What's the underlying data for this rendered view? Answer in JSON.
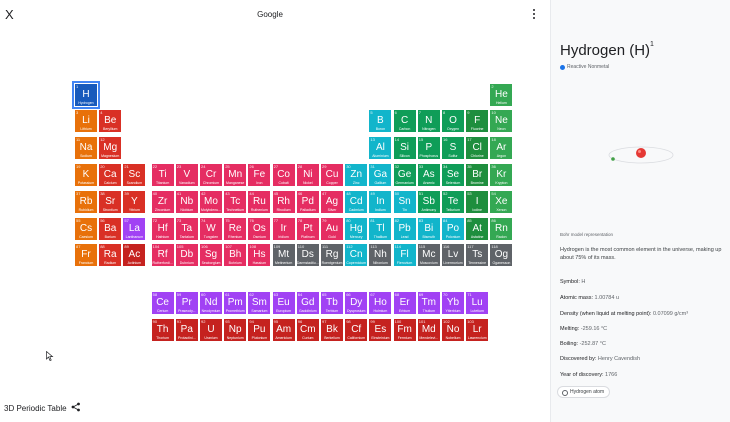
{
  "header": {
    "title": "Google",
    "close_glyph": "X"
  },
  "footer": {
    "app_title": "3D Periodic Table"
  },
  "colors": {
    "alkali": "#e8710a",
    "alkaline": "#d93025",
    "transition": "#e52d62",
    "post": "#12b5cb",
    "metalloid": "#0f9d58",
    "nonmetal": "#188038",
    "halogen": "#1e8e3e",
    "noble": "#34a853",
    "lanth": "#a142f4",
    "actin": "#c5221f",
    "unknown": "#5f6368",
    "hydrogen": "#185abc"
  },
  "elements": [
    {
      "z": 1,
      "s": "H",
      "n": "Hydrogen",
      "r": 1,
      "c": 1,
      "cat": "hydrogen"
    },
    {
      "z": 2,
      "s": "He",
      "n": "Helium",
      "r": 1,
      "c": 18,
      "cat": "noble"
    },
    {
      "z": 3,
      "s": "Li",
      "n": "Lithium",
      "r": 2,
      "c": 1,
      "cat": "alkali"
    },
    {
      "z": 4,
      "s": "Be",
      "n": "Beryllium",
      "r": 2,
      "c": 2,
      "cat": "alkaline"
    },
    {
      "z": 5,
      "s": "B",
      "n": "Boron",
      "r": 2,
      "c": 13,
      "cat": "post"
    },
    {
      "z": 6,
      "s": "C",
      "n": "Carbon",
      "r": 2,
      "c": 14,
      "cat": "metalloid"
    },
    {
      "z": 7,
      "s": "N",
      "n": "Nitrogen",
      "r": 2,
      "c": 15,
      "cat": "metalloid"
    },
    {
      "z": 8,
      "s": "O",
      "n": "Oxygen",
      "r": 2,
      "c": 16,
      "cat": "metalloid"
    },
    {
      "z": 9,
      "s": "F",
      "n": "Fluorine",
      "r": 2,
      "c": 17,
      "cat": "halogen"
    },
    {
      "z": 10,
      "s": "Ne",
      "n": "Neon",
      "r": 2,
      "c": 18,
      "cat": "noble"
    },
    {
      "z": 11,
      "s": "Na",
      "n": "Sodium",
      "r": 3,
      "c": 1,
      "cat": "alkali"
    },
    {
      "z": 12,
      "s": "Mg",
      "n": "Magnesium",
      "r": 3,
      "c": 2,
      "cat": "alkaline"
    },
    {
      "z": 13,
      "s": "Al",
      "n": "Aluminium",
      "r": 3,
      "c": 13,
      "cat": "post"
    },
    {
      "z": 14,
      "s": "Si",
      "n": "Silicon",
      "r": 3,
      "c": 14,
      "cat": "metalloid"
    },
    {
      "z": 15,
      "s": "P",
      "n": "Phosphorus",
      "r": 3,
      "c": 15,
      "cat": "metalloid"
    },
    {
      "z": 16,
      "s": "S",
      "n": "Sulfur",
      "r": 3,
      "c": 16,
      "cat": "metalloid"
    },
    {
      "z": 17,
      "s": "Cl",
      "n": "Chlorine",
      "r": 3,
      "c": 17,
      "cat": "halogen"
    },
    {
      "z": 18,
      "s": "Ar",
      "n": "Argon",
      "r": 3,
      "c": 18,
      "cat": "noble"
    },
    {
      "z": 19,
      "s": "K",
      "n": "Potassium",
      "r": 4,
      "c": 1,
      "cat": "alkali"
    },
    {
      "z": 20,
      "s": "Ca",
      "n": "Calcium",
      "r": 4,
      "c": 2,
      "cat": "alkaline"
    },
    {
      "z": 21,
      "s": "Sc",
      "n": "Scandium",
      "r": 4,
      "c": 3,
      "cat": "alkaline"
    },
    {
      "z": 22,
      "s": "Ti",
      "n": "Titanium",
      "r": 4,
      "c": 4,
      "cat": "transition"
    },
    {
      "z": 23,
      "s": "V",
      "n": "Vanadium",
      "r": 4,
      "c": 5,
      "cat": "transition"
    },
    {
      "z": 24,
      "s": "Cr",
      "n": "Chromium",
      "r": 4,
      "c": 6,
      "cat": "transition"
    },
    {
      "z": 25,
      "s": "Mn",
      "n": "Manganese",
      "r": 4,
      "c": 7,
      "cat": "transition"
    },
    {
      "z": 26,
      "s": "Fe",
      "n": "Iron",
      "r": 4,
      "c": 8,
      "cat": "transition"
    },
    {
      "z": 27,
      "s": "Co",
      "n": "Cobalt",
      "r": 4,
      "c": 9,
      "cat": "transition"
    },
    {
      "z": 28,
      "s": "Ni",
      "n": "Nickel",
      "r": 4,
      "c": 10,
      "cat": "transition"
    },
    {
      "z": 29,
      "s": "Cu",
      "n": "Copper",
      "r": 4,
      "c": 11,
      "cat": "transition"
    },
    {
      "z": 30,
      "s": "Zn",
      "n": "Zinc",
      "r": 4,
      "c": 12,
      "cat": "post"
    },
    {
      "z": 31,
      "s": "Ga",
      "n": "Gallium",
      "r": 4,
      "c": 13,
      "cat": "post"
    },
    {
      "z": 32,
      "s": "Ge",
      "n": "Germanium",
      "r": 4,
      "c": 14,
      "cat": "metalloid"
    },
    {
      "z": 33,
      "s": "As",
      "n": "Arsenic",
      "r": 4,
      "c": 15,
      "cat": "metalloid"
    },
    {
      "z": 34,
      "s": "Se",
      "n": "Selenium",
      "r": 4,
      "c": 16,
      "cat": "metalloid"
    },
    {
      "z": 35,
      "s": "Br",
      "n": "Bromine",
      "r": 4,
      "c": 17,
      "cat": "halogen"
    },
    {
      "z": 36,
      "s": "Kr",
      "n": "Krypton",
      "r": 4,
      "c": 18,
      "cat": "noble"
    },
    {
      "z": 37,
      "s": "Rb",
      "n": "Rubidium",
      "r": 5,
      "c": 1,
      "cat": "alkali"
    },
    {
      "z": 38,
      "s": "Sr",
      "n": "Strontium",
      "r": 5,
      "c": 2,
      "cat": "alkaline"
    },
    {
      "z": 39,
      "s": "Y",
      "n": "Yttrium",
      "r": 5,
      "c": 3,
      "cat": "alkaline"
    },
    {
      "z": 40,
      "s": "Zr",
      "n": "Zirconium",
      "r": 5,
      "c": 4,
      "cat": "transition"
    },
    {
      "z": 41,
      "s": "Nb",
      "n": "Niobium",
      "r": 5,
      "c": 5,
      "cat": "transition"
    },
    {
      "z": 42,
      "s": "Mo",
      "n": "Molybdenu...",
      "r": 5,
      "c": 6,
      "cat": "transition"
    },
    {
      "z": 43,
      "s": "Tc",
      "n": "Technetium",
      "r": 5,
      "c": 7,
      "cat": "transition"
    },
    {
      "z": 44,
      "s": "Ru",
      "n": "Ruthenium",
      "r": 5,
      "c": 8,
      "cat": "transition"
    },
    {
      "z": 45,
      "s": "Rh",
      "n": "Rhodium",
      "r": 5,
      "c": 9,
      "cat": "transition"
    },
    {
      "z": 46,
      "s": "Pd",
      "n": "Palladium",
      "r": 5,
      "c": 10,
      "cat": "transition"
    },
    {
      "z": 47,
      "s": "Ag",
      "n": "Silver",
      "r": 5,
      "c": 11,
      "cat": "transition"
    },
    {
      "z": 48,
      "s": "Cd",
      "n": "Cadmium",
      "r": 5,
      "c": 12,
      "cat": "post"
    },
    {
      "z": 49,
      "s": "In",
      "n": "Indium",
      "r": 5,
      "c": 13,
      "cat": "post"
    },
    {
      "z": 50,
      "s": "Sn",
      "n": "Tin",
      "r": 5,
      "c": 14,
      "cat": "post"
    },
    {
      "z": 51,
      "s": "Sb",
      "n": "Antimony",
      "r": 5,
      "c": 15,
      "cat": "metalloid"
    },
    {
      "z": 52,
      "s": "Te",
      "n": "Tellurium",
      "r": 5,
      "c": 16,
      "cat": "metalloid"
    },
    {
      "z": 53,
      "s": "I",
      "n": "Iodine",
      "r": 5,
      "c": 17,
      "cat": "halogen"
    },
    {
      "z": 54,
      "s": "Xe",
      "n": "Xenon",
      "r": 5,
      "c": 18,
      "cat": "noble"
    },
    {
      "z": 55,
      "s": "Cs",
      "n": "Caesium",
      "r": 6,
      "c": 1,
      "cat": "alkali"
    },
    {
      "z": 56,
      "s": "Ba",
      "n": "Barium",
      "r": 6,
      "c": 2,
      "cat": "alkaline"
    },
    {
      "z": 57,
      "s": "La",
      "n": "Lanthanum",
      "r": 6,
      "c": 3,
      "cat": "lanth"
    },
    {
      "z": 72,
      "s": "Hf",
      "n": "Hafnium",
      "r": 6,
      "c": 4,
      "cat": "transition"
    },
    {
      "z": 73,
      "s": "Ta",
      "n": "Tantalum",
      "r": 6,
      "c": 5,
      "cat": "transition"
    },
    {
      "z": 74,
      "s": "W",
      "n": "Tungsten",
      "r": 6,
      "c": 6,
      "cat": "transition"
    },
    {
      "z": 75,
      "s": "Re",
      "n": "Rhenium",
      "r": 6,
      "c": 7,
      "cat": "transition"
    },
    {
      "z": 76,
      "s": "Os",
      "n": "Osmium",
      "r": 6,
      "c": 8,
      "cat": "transition"
    },
    {
      "z": 77,
      "s": "Ir",
      "n": "Iridium",
      "r": 6,
      "c": 9,
      "cat": "transition"
    },
    {
      "z": 78,
      "s": "Pt",
      "n": "Platinum",
      "r": 6,
      "c": 10,
      "cat": "transition"
    },
    {
      "z": 79,
      "s": "Au",
      "n": "Gold",
      "r": 6,
      "c": 11,
      "cat": "transition"
    },
    {
      "z": 80,
      "s": "Hg",
      "n": "Mercury",
      "r": 6,
      "c": 12,
      "cat": "post"
    },
    {
      "z": 81,
      "s": "Tl",
      "n": "Thallium",
      "r": 6,
      "c": 13,
      "cat": "post"
    },
    {
      "z": 82,
      "s": "Pb",
      "n": "Lead",
      "r": 6,
      "c": 14,
      "cat": "post"
    },
    {
      "z": 83,
      "s": "Bi",
      "n": "Bismuth",
      "r": 6,
      "c": 15,
      "cat": "post"
    },
    {
      "z": 84,
      "s": "Po",
      "n": "Polonium",
      "r": 6,
      "c": 16,
      "cat": "post"
    },
    {
      "z": 85,
      "s": "At",
      "n": "Astatine",
      "r": 6,
      "c": 17,
      "cat": "halogen"
    },
    {
      "z": 86,
      "s": "Rn",
      "n": "Radon",
      "r": 6,
      "c": 18,
      "cat": "noble"
    },
    {
      "z": 87,
      "s": "Fr",
      "n": "Francium",
      "r": 7,
      "c": 1,
      "cat": "alkali"
    },
    {
      "z": 88,
      "s": "Ra",
      "n": "Radium",
      "r": 7,
      "c": 2,
      "cat": "alkaline"
    },
    {
      "z": 89,
      "s": "Ac",
      "n": "Actinium",
      "r": 7,
      "c": 3,
      "cat": "actin"
    },
    {
      "z": 104,
      "s": "Rf",
      "n": "Rutherfordi...",
      "r": 7,
      "c": 4,
      "cat": "transition"
    },
    {
      "z": 105,
      "s": "Db",
      "n": "Dubnium",
      "r": 7,
      "c": 5,
      "cat": "transition"
    },
    {
      "z": 106,
      "s": "Sg",
      "n": "Seaborgium",
      "r": 7,
      "c": 6,
      "cat": "transition"
    },
    {
      "z": 107,
      "s": "Bh",
      "n": "Bohrium",
      "r": 7,
      "c": 7,
      "cat": "transition"
    },
    {
      "z": 108,
      "s": "Hs",
      "n": "Hassium",
      "r": 7,
      "c": 8,
      "cat": "transition"
    },
    {
      "z": 109,
      "s": "Mt",
      "n": "Meitnerium",
      "r": 7,
      "c": 9,
      "cat": "unknown"
    },
    {
      "z": 110,
      "s": "Ds",
      "n": "Darmstadtiu...",
      "r": 7,
      "c": 10,
      "cat": "unknown"
    },
    {
      "z": 111,
      "s": "Rg",
      "n": "Roentgenium",
      "r": 7,
      "c": 11,
      "cat": "unknown"
    },
    {
      "z": 112,
      "s": "Cn",
      "n": "Copernicium",
      "r": 7,
      "c": 12,
      "cat": "post"
    },
    {
      "z": 113,
      "s": "Nh",
      "n": "Nihonium",
      "r": 7,
      "c": 13,
      "cat": "unknown"
    },
    {
      "z": 114,
      "s": "Fl",
      "n": "Flerovium",
      "r": 7,
      "c": 14,
      "cat": "post"
    },
    {
      "z": 115,
      "s": "Mc",
      "n": "Moscovium",
      "r": 7,
      "c": 15,
      "cat": "unknown"
    },
    {
      "z": 116,
      "s": "Lv",
      "n": "Livermorium",
      "r": 7,
      "c": 16,
      "cat": "unknown"
    },
    {
      "z": 117,
      "s": "Ts",
      "n": "Tennessine",
      "r": 7,
      "c": 17,
      "cat": "unknown"
    },
    {
      "z": 118,
      "s": "Og",
      "n": "Oganesson",
      "r": 7,
      "c": 18,
      "cat": "unknown"
    },
    {
      "z": 58,
      "s": "Ce",
      "n": "Cerium",
      "r": 9,
      "c": 4,
      "cat": "lanth"
    },
    {
      "z": 59,
      "s": "Pr",
      "n": "Praseody...",
      "r": 9,
      "c": 5,
      "cat": "lanth"
    },
    {
      "z": 60,
      "s": "Nd",
      "n": "Neodymium",
      "r": 9,
      "c": 6,
      "cat": "lanth"
    },
    {
      "z": 61,
      "s": "Pm",
      "n": "Promethium",
      "r": 9,
      "c": 7,
      "cat": "lanth"
    },
    {
      "z": 62,
      "s": "Sm",
      "n": "Samarium",
      "r": 9,
      "c": 8,
      "cat": "lanth"
    },
    {
      "z": 63,
      "s": "Eu",
      "n": "Europium",
      "r": 9,
      "c": 9,
      "cat": "lanth"
    },
    {
      "z": 64,
      "s": "Gd",
      "n": "Gadolinium",
      "r": 9,
      "c": 10,
      "cat": "lanth"
    },
    {
      "z": 65,
      "s": "Tb",
      "n": "Terbium",
      "r": 9,
      "c": 11,
      "cat": "lanth"
    },
    {
      "z": 66,
      "s": "Dy",
      "n": "Dysprosium",
      "r": 9,
      "c": 12,
      "cat": "lanth"
    },
    {
      "z": 67,
      "s": "Ho",
      "n": "Holmium",
      "r": 9,
      "c": 13,
      "cat": "lanth"
    },
    {
      "z": 68,
      "s": "Er",
      "n": "Erbium",
      "r": 9,
      "c": 14,
      "cat": "lanth"
    },
    {
      "z": 69,
      "s": "Tm",
      "n": "Thulium",
      "r": 9,
      "c": 15,
      "cat": "lanth"
    },
    {
      "z": 70,
      "s": "Yb",
      "n": "Ytterbium",
      "r": 9,
      "c": 16,
      "cat": "lanth"
    },
    {
      "z": 71,
      "s": "Lu",
      "n": "Lutetium",
      "r": 9,
      "c": 17,
      "cat": "lanth"
    },
    {
      "z": 90,
      "s": "Th",
      "n": "Thorium",
      "r": 10,
      "c": 4,
      "cat": "actin"
    },
    {
      "z": 91,
      "s": "Pa",
      "n": "Protactini...",
      "r": 10,
      "c": 5,
      "cat": "actin"
    },
    {
      "z": 92,
      "s": "U",
      "n": "Uranium",
      "r": 10,
      "c": 6,
      "cat": "actin"
    },
    {
      "z": 93,
      "s": "Np",
      "n": "Neptunium",
      "r": 10,
      "c": 7,
      "cat": "actin"
    },
    {
      "z": 94,
      "s": "Pu",
      "n": "Plutonium",
      "r": 10,
      "c": 8,
      "cat": "actin"
    },
    {
      "z": 95,
      "s": "Am",
      "n": "Americium",
      "r": 10,
      "c": 9,
      "cat": "actin"
    },
    {
      "z": 96,
      "s": "Cm",
      "n": "Curium",
      "r": 10,
      "c": 10,
      "cat": "actin"
    },
    {
      "z": 97,
      "s": "Bk",
      "n": "Berkelium",
      "r": 10,
      "c": 11,
      "cat": "actin"
    },
    {
      "z": 98,
      "s": "Cf",
      "n": "Californium",
      "r": 10,
      "c": 12,
      "cat": "actin"
    },
    {
      "z": 99,
      "s": "Es",
      "n": "Einsteinium",
      "r": 10,
      "c": 13,
      "cat": "actin"
    },
    {
      "z": 100,
      "s": "Fm",
      "n": "Fermium",
      "r": 10,
      "c": 14,
      "cat": "actin"
    },
    {
      "z": 101,
      "s": "Md",
      "n": "Mendelevi...",
      "r": 10,
      "c": 15,
      "cat": "actin"
    },
    {
      "z": 102,
      "s": "No",
      "n": "Nobelium",
      "r": 10,
      "c": 16,
      "cat": "actin"
    },
    {
      "z": 103,
      "s": "Lr",
      "n": "Lawrencium",
      "r": 10,
      "c": 17,
      "cat": "actin"
    }
  ],
  "panel": {
    "element_name": "Hydrogen (H)",
    "atomic_number": "1",
    "category": "Reactive Nonmetal",
    "model_caption": "Bohr model representation",
    "description": "Hydrogen is the most common element in the universe, making up about 75% of its mass.",
    "symbol_label": "Symbol:",
    "symbol_value": "H",
    "mass_label": "Atomic mass:",
    "mass_value": "1.00784 u",
    "density_label": "Density (when liquid at melting point):",
    "density_value": "0.07099 g/cm³",
    "melting_label": "Melting:",
    "melting_value": "-259.16 °C",
    "boiling_label": "Boiling:",
    "boiling_value": "-252.87 °C",
    "discovered_label": "Discovered by:",
    "discovered_value": "Henry Cavendish",
    "year_label": "Year of discovery:",
    "year_value": "1766",
    "chip_label": "Hydrogen atom"
  }
}
